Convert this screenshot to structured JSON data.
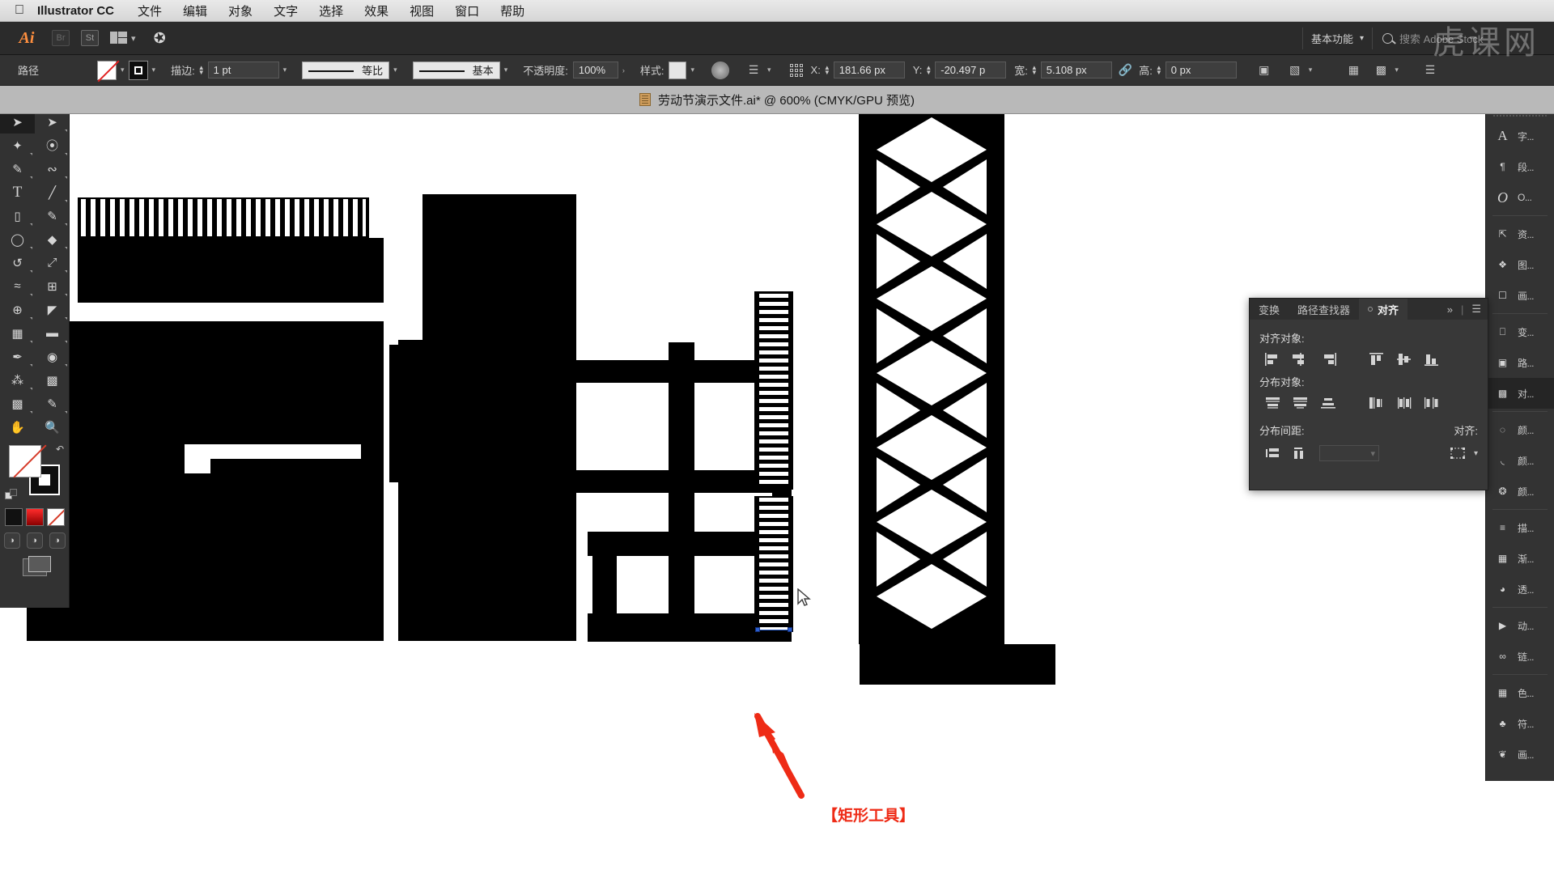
{
  "os_menu": {
    "apple_icon": "apple-icon",
    "app_name": "Illustrator CC",
    "items": [
      "文件",
      "编辑",
      "对象",
      "文字",
      "选择",
      "效果",
      "视图",
      "窗口",
      "帮助"
    ]
  },
  "app_bar": {
    "logo": "Ai",
    "bridge_label": "Br",
    "stock_label": "St",
    "arrange_icon": "arrange-documents-icon",
    "chevron_icon": "chevron-down-icon",
    "rocket_icon": "rocket-icon",
    "workspace": "基本功能",
    "workspace_chevron": "chevron-down-icon",
    "search_icon": "search-icon",
    "search_placeholder": "搜索 Adobe Stock"
  },
  "control_bar": {
    "object_type": "路径",
    "fill_swatch": "none-fill-swatch",
    "stroke_swatch": "stroke-swatch",
    "stroke_label": "描边:",
    "stroke_weight": "1 pt",
    "stroke_profile": "等比",
    "brush_definition": "基本",
    "opacity_label": "不透明度:",
    "opacity_value": "100%",
    "style_label": "样式:",
    "recolor_icon": "recolor-artwork-icon",
    "transform_icon": "transform-icon",
    "anchor_icon": "reference-point-icon",
    "x_label": "X:",
    "x_value": "181.66 px",
    "y_label": "Y:",
    "y_value": "-20.497 p",
    "w_label": "宽:",
    "w_value": "5.108 px",
    "lock_icon": "constrain-proportions-off-icon",
    "h_label": "高:",
    "h_value": "0 px",
    "isolate_icon": "isolate-selected-icon",
    "select_similar_icon": "select-similar-icon",
    "align_grid_icon": "align-grid-icon",
    "align_icon": "align-icon",
    "document_setup_icon": "document-setup-icon"
  },
  "document_tab": {
    "icon": "ai-document-icon",
    "title": "劳动节演示文件.ai* @ 600% (CMYK/GPU 预览)"
  },
  "toolbar": {
    "close_icon": "close-icon",
    "collapse_icon": "collapse-panel-icon",
    "tools": [
      {
        "name": "selection-tool",
        "glyph": "➤",
        "selected": true
      },
      {
        "name": "direct-selection-tool",
        "glyph": "➤",
        "selected": false
      },
      {
        "name": "magic-wand-tool",
        "glyph": "✨",
        "selected": false
      },
      {
        "name": "lasso-tool",
        "glyph": "🔗",
        "selected": false
      },
      {
        "name": "pen-tool",
        "glyph": "✒",
        "selected": false
      },
      {
        "name": "curvature-tool",
        "glyph": "∿",
        "selected": false
      },
      {
        "name": "type-tool",
        "glyph": "T",
        "selected": false
      },
      {
        "name": "line-segment-tool",
        "glyph": "／",
        "selected": false
      },
      {
        "name": "rectangle-tool",
        "glyph": "▭",
        "selected": false
      },
      {
        "name": "paintbrush-tool",
        "glyph": "🖌",
        "selected": false
      },
      {
        "name": "shaper-tool",
        "glyph": "◯",
        "selected": false
      },
      {
        "name": "eraser-tool",
        "glyph": "◆",
        "selected": false
      },
      {
        "name": "rotate-tool",
        "glyph": "↻",
        "selected": false
      },
      {
        "name": "scale-tool",
        "glyph": "⤢",
        "selected": false
      },
      {
        "name": "width-tool",
        "glyph": "≋",
        "selected": false
      },
      {
        "name": "free-transform-tool",
        "glyph": "⊞",
        "selected": false
      },
      {
        "name": "shape-builder-tool",
        "glyph": "⊕",
        "selected": false
      },
      {
        "name": "perspective-grid-tool",
        "glyph": "▰",
        "selected": false
      },
      {
        "name": "mesh-tool",
        "glyph": "▩",
        "selected": false
      },
      {
        "name": "gradient-tool",
        "glyph": "▤",
        "selected": false
      },
      {
        "name": "eyedropper-tool",
        "glyph": "✐",
        "selected": false
      },
      {
        "name": "blend-tool",
        "glyph": "◉",
        "selected": false
      },
      {
        "name": "symbol-sprayer-tool",
        "glyph": "⁂",
        "selected": false
      },
      {
        "name": "column-graph-tool",
        "glyph": "▥",
        "selected": false
      },
      {
        "name": "artboard-tool",
        "glyph": "⬓",
        "selected": false
      },
      {
        "name": "slice-tool",
        "glyph": "✎",
        "selected": false
      },
      {
        "name": "hand-tool",
        "glyph": "✋",
        "selected": false
      },
      {
        "name": "zoom-tool",
        "glyph": "🔍",
        "selected": false
      }
    ],
    "fill_name": "fill-swatch-none",
    "stroke_name": "stroke-swatch-black",
    "swap_icon": "swap-fill-stroke-icon",
    "default_icon": "default-fill-stroke-icon",
    "color_modes": [
      "color-swatch-black",
      "gradient-swatch-red",
      "none-swatch"
    ],
    "screen_modes": [
      "draw-normal-icon",
      "draw-behind-icon",
      "draw-inside-icon"
    ],
    "screen_mode_icon": "change-screen-mode-icon"
  },
  "align_panel": {
    "tabs": [
      {
        "label": "变换",
        "active": false
      },
      {
        "label": "路径查找器",
        "active": false
      },
      {
        "label": "对齐",
        "active": true
      }
    ],
    "expand_icon": "expand-panel-icon",
    "menu_icon": "panel-menu-icon",
    "align_objects_label": "对齐对象:",
    "align_buttons": [
      "align-left-icon",
      "align-horizontal-center-icon",
      "align-right-icon",
      "align-top-icon",
      "align-vertical-center-icon",
      "align-bottom-icon"
    ],
    "distribute_objects_label": "分布对象:",
    "distribute_buttons": [
      "distribute-vertical-top-icon",
      "distribute-vertical-center-icon",
      "distribute-vertical-bottom-icon",
      "distribute-horizontal-left-icon",
      "distribute-horizontal-center-icon",
      "distribute-horizontal-right-icon"
    ],
    "distribute_spacing_label": "分布间距:",
    "spacing_buttons": [
      "distribute-vertical-space-icon",
      "distribute-horizontal-space-icon"
    ],
    "spacing_value": "",
    "align_to_label": "对齐:",
    "align_to_icon": "align-to-selection-icon"
  },
  "dock": {
    "close_icon": "close-icon",
    "expand_icon": "expand-panels-icon",
    "groups": [
      [
        {
          "icon": "character-panel-icon",
          "label": "字...",
          "glyph": "A"
        },
        {
          "icon": "paragraph-panel-icon",
          "label": "段...",
          "glyph": "¶"
        },
        {
          "icon": "opentype-panel-icon",
          "label": "O...",
          "glyph": "O"
        }
      ],
      [
        {
          "icon": "asset-export-panel-icon",
          "label": "资...",
          "glyph": "⇱"
        },
        {
          "icon": "layers-panel-icon",
          "label": "图...",
          "glyph": "◆"
        },
        {
          "icon": "artboards-panel-icon",
          "label": "画...",
          "glyph": "▢"
        }
      ],
      [
        {
          "icon": "transform-panel-icon",
          "label": "变...",
          "glyph": "⬚"
        },
        {
          "icon": "pathfinder-panel-icon",
          "label": "路...",
          "glyph": "▣"
        },
        {
          "icon": "align-panel-icon",
          "label": "对...",
          "glyph": "▤",
          "active": true
        }
      ],
      [
        {
          "icon": "color-panel-icon",
          "label": "颜...",
          "glyph": "◍"
        },
        {
          "icon": "color-guide-panel-icon",
          "label": "颜...",
          "glyph": "◗"
        },
        {
          "icon": "color-themes-panel-icon",
          "label": "颜...",
          "glyph": "❂"
        }
      ],
      [
        {
          "icon": "stroke-panel-icon",
          "label": "描...",
          "glyph": "≡"
        },
        {
          "icon": "gradient-panel-icon",
          "label": "渐...",
          "glyph": "▦"
        },
        {
          "icon": "transparency-panel-icon",
          "label": "透...",
          "glyph": "◑"
        }
      ],
      [
        {
          "icon": "actions-panel-icon",
          "label": "动...",
          "glyph": "▶"
        },
        {
          "icon": "links-panel-icon",
          "label": "链...",
          "glyph": "∞"
        }
      ],
      [
        {
          "icon": "swatches-panel-icon",
          "label": "色...",
          "glyph": "▩"
        },
        {
          "icon": "symbols-panel-icon",
          "label": "符...",
          "glyph": "♣"
        },
        {
          "icon": "brushes-panel-icon",
          "label": "画...",
          "glyph": "❦"
        }
      ]
    ]
  },
  "annotation": {
    "text": "【矩形工具】",
    "color": "#ee2b16",
    "arrow": "red-arrow-pointer"
  },
  "watermark": {
    "text": "虎课网"
  },
  "canvas": {
    "cursor": "selection-arrow-cursor",
    "selection": "selected-rectangle-handles"
  }
}
